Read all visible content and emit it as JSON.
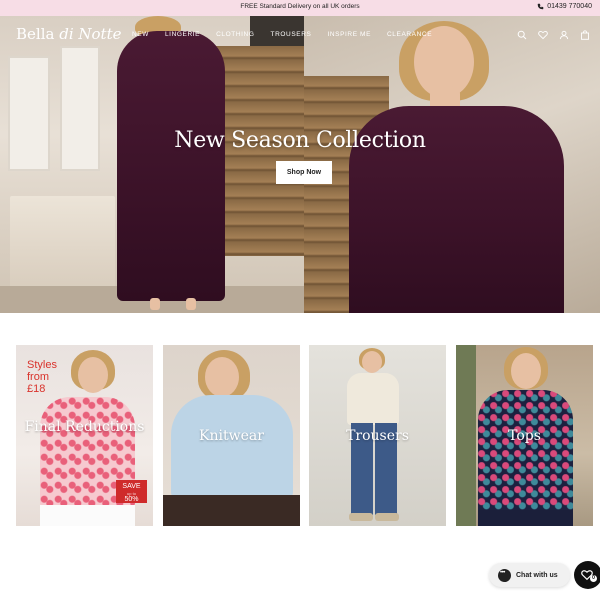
{
  "announcement": {
    "promo": "FREE Standard Delivery on all UK orders",
    "phone": "01439 770040"
  },
  "header": {
    "logo_part1": "Bella",
    "logo_part2": "di Notte",
    "nav": [
      "NEW",
      "LINGERIE",
      "CLOTHING",
      "TROUSERS",
      "INSPIRE ME",
      "CLEARANCE"
    ],
    "icons": [
      "search-icon",
      "heart-icon",
      "account-icon",
      "bag-icon"
    ]
  },
  "hero": {
    "title": "New Season Collection",
    "button": "Shop Now"
  },
  "categories": [
    {
      "label": "Final Reductions",
      "promo_line1": "Styles",
      "promo_line2": "from",
      "promo_line3": "£18",
      "badge_top": "SAVE",
      "badge_mid": "up to",
      "badge_bottom": "50%"
    },
    {
      "label": "Knitwear"
    },
    {
      "label": "Trousers"
    },
    {
      "label": "Tops"
    }
  ],
  "chat": {
    "label": "Chat with us"
  },
  "wishlist_fab": {
    "count": "0"
  },
  "colors": {
    "announcement_bg": "#f7dde6",
    "promo_red": "#d9332c",
    "badge_red": "#cf2b2b",
    "dress_plum": "#4a1a33"
  }
}
